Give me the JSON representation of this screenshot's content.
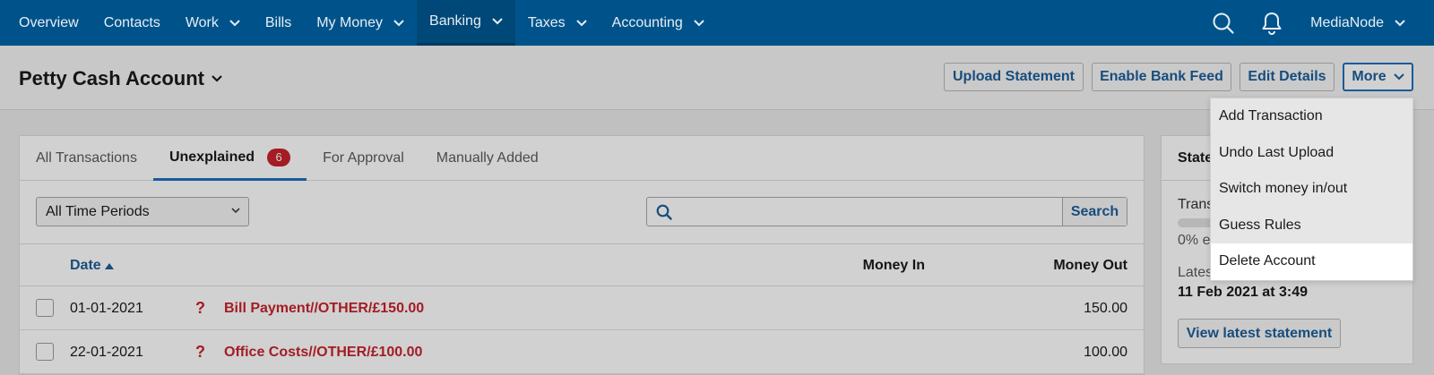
{
  "nav": {
    "items": [
      {
        "label": "Overview",
        "dropdown": false
      },
      {
        "label": "Contacts",
        "dropdown": false
      },
      {
        "label": "Work",
        "dropdown": true
      },
      {
        "label": "Bills",
        "dropdown": false
      },
      {
        "label": "My Money",
        "dropdown": true
      },
      {
        "label": "Banking",
        "dropdown": true,
        "active": true
      },
      {
        "label": "Taxes",
        "dropdown": true
      },
      {
        "label": "Accounting",
        "dropdown": true
      }
    ],
    "user": "MediaNode",
    "search_icon": "search-icon",
    "bell_icon": "bell-icon"
  },
  "header": {
    "title": "Petty Cash Account",
    "buttons": {
      "upload": "Upload Statement",
      "bank_feed": "Enable Bank Feed",
      "edit": "Edit Details",
      "more": "More"
    }
  },
  "dropdown": {
    "items": [
      "Add Transaction",
      "Undo Last Upload",
      "Switch money in/out",
      "Guess Rules",
      "Delete Account"
    ],
    "highlighted_index": 4
  },
  "tabs": {
    "all": "All Transactions",
    "unexplained": "Unexplained",
    "unexplained_count": "6",
    "approval": "For Approval",
    "manual": "Manually Added"
  },
  "filters": {
    "period": "All Time Periods",
    "search_placeholder": "",
    "search_button": "Search"
  },
  "table": {
    "col_date": "Date",
    "col_in": "Money In",
    "col_out": "Money Out",
    "rows": [
      {
        "date": "01-01-2021",
        "flag": "?",
        "description": "Bill Payment//OTHER/£150.00",
        "money_in": "",
        "money_out": "150.00"
      },
      {
        "date": "22-01-2021",
        "flag": "?",
        "description": "Office Costs//OTHER/£100.00",
        "money_in": "",
        "money_out": "100.00"
      }
    ]
  },
  "side": {
    "title": "State",
    "label": "Trans",
    "pct": "0% e",
    "latest_label": "Lates",
    "latest_date": "11 Feb 2021 at 3:49",
    "button": "View latest statement"
  },
  "colors": {
    "nav_bg": "#00538a",
    "accent": "#1d5e99",
    "alert": "#c8232c"
  }
}
